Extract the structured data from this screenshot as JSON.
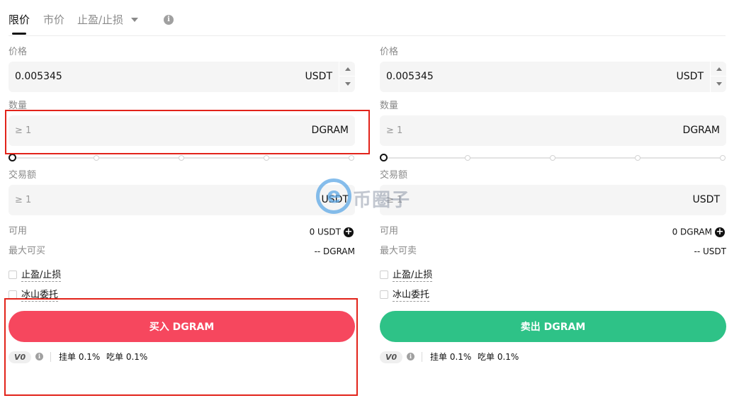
{
  "tabs": {
    "limit": "限价",
    "market": "市价",
    "tpsl": "止盈/止损"
  },
  "info_icon_glyph": "i",
  "buy": {
    "price_label": "价格",
    "price_value": "0.005345",
    "price_unit": "USDT",
    "amount_label": "数量",
    "amount_placeholder": "≥ 1",
    "amount_unit": "DGRAM",
    "slider_value_percent": 0,
    "total_label": "交易额",
    "total_placeholder": "≥ 1",
    "total_unit": "USDT",
    "available_label": "可用",
    "available_value": "0 USDT",
    "max_label": "最大可买",
    "max_value": "-- DGRAM",
    "tpsl_label": "止盈/止损",
    "iceberg_label": "冰山委托",
    "action_label": "买入 DGRAM",
    "vip_level": "V0",
    "maker_fee": "挂单 0.1%",
    "taker_fee": "吃单 0.1%"
  },
  "sell": {
    "price_label": "价格",
    "price_value": "0.005345",
    "price_unit": "USDT",
    "amount_label": "数量",
    "amount_placeholder": "≥ 1",
    "amount_unit": "DGRAM",
    "slider_value_percent": 0,
    "total_label": "交易额",
    "total_placeholder": "≥ 1",
    "total_unit": "USDT",
    "available_label": "可用",
    "available_value": "0 DGRAM",
    "max_label": "最大可卖",
    "max_value": "-- USDT",
    "tpsl_label": "止盈/止损",
    "iceberg_label": "冰山委托",
    "action_label": "卖出 DGRAM",
    "vip_level": "V0",
    "maker_fee": "挂单 0.1%",
    "taker_fee": "吃单 0.1%"
  },
  "watermark": {
    "text": "币圈子"
  },
  "colors": {
    "buy": "#f6475e",
    "sell": "#2ec287",
    "highlight_box": "#e2231a",
    "input_bg": "#f5f5f5"
  },
  "icons": {
    "add": "plus-circle-icon",
    "info": "info-icon",
    "dropdown": "caret-down-icon"
  }
}
